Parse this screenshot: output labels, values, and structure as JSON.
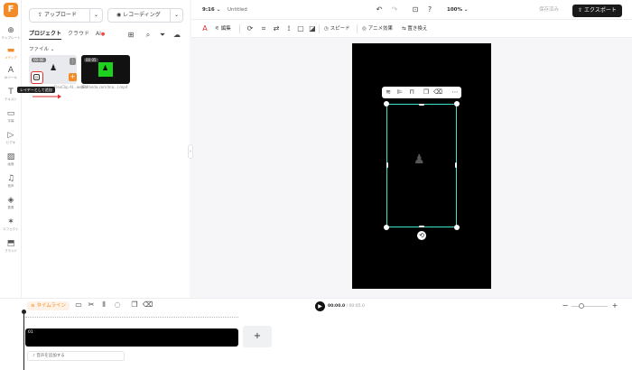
{
  "nav": {
    "logo": "F",
    "items": [
      {
        "icon": "template-icon",
        "label": "テンプレート",
        "glyph": "⊕"
      },
      {
        "icon": "media-icon",
        "label": "メディア",
        "glyph": "▬"
      },
      {
        "icon": "ai-tools-icon",
        "label": "AIツール",
        "glyph": "A"
      },
      {
        "icon": "text-icon",
        "label": "テキスト",
        "glyph": "T"
      },
      {
        "icon": "subtitle-icon",
        "label": "字幕",
        "glyph": "▭"
      },
      {
        "icon": "video-icon",
        "label": "ビデオ",
        "glyph": "▷"
      },
      {
        "icon": "image-icon",
        "label": "画像",
        "glyph": "▨"
      },
      {
        "icon": "audio-icon",
        "label": "音声",
        "glyph": "♫"
      },
      {
        "icon": "element-icon",
        "label": "要素",
        "glyph": "◈"
      },
      {
        "icon": "effect-icon",
        "label": "エフェクト",
        "glyph": "✶"
      },
      {
        "icon": "brand-icon",
        "label": "ブランド",
        "glyph": "⬒"
      }
    ]
  },
  "panel": {
    "upload_label": "アップロード",
    "record_label": "レコーディング",
    "tabs": [
      {
        "label": "プロジェクト",
        "active": true
      },
      {
        "label": "クラウド",
        "active": false
      },
      {
        "label": "AI",
        "active": false
      }
    ],
    "filter_label": "ファイル",
    "thumbs": [
      {
        "duration": "00:06",
        "caption": "FlexClip AI…webm"
      },
      {
        "duration": "00:05",
        "caption": "[FLPanda.com]ma…l.mp4"
      }
    ],
    "tooltip": "レイヤーとして追加"
  },
  "topbar": {
    "ratio": "9:16",
    "title": "Untitled",
    "zoom": "100%",
    "save_status": "保存済み",
    "export_label": "エクスポート"
  },
  "edit_toolbar": {
    "edit_label": "編集",
    "speed_label": "スピード",
    "animation_label": "アニメ効果",
    "replace_label": "置き換え"
  },
  "timeline": {
    "label": "タイムライン",
    "current_time": "00:00.0",
    "total_time": "/ 00:05.0",
    "clip_number": "01",
    "audio_placeholder": "音声を追加する"
  },
  "colors": {
    "accent": "#f28c28",
    "selection": "#3ee0d0",
    "export_bg": "#1a1a1a",
    "thumb_green": "#1fd11f"
  }
}
